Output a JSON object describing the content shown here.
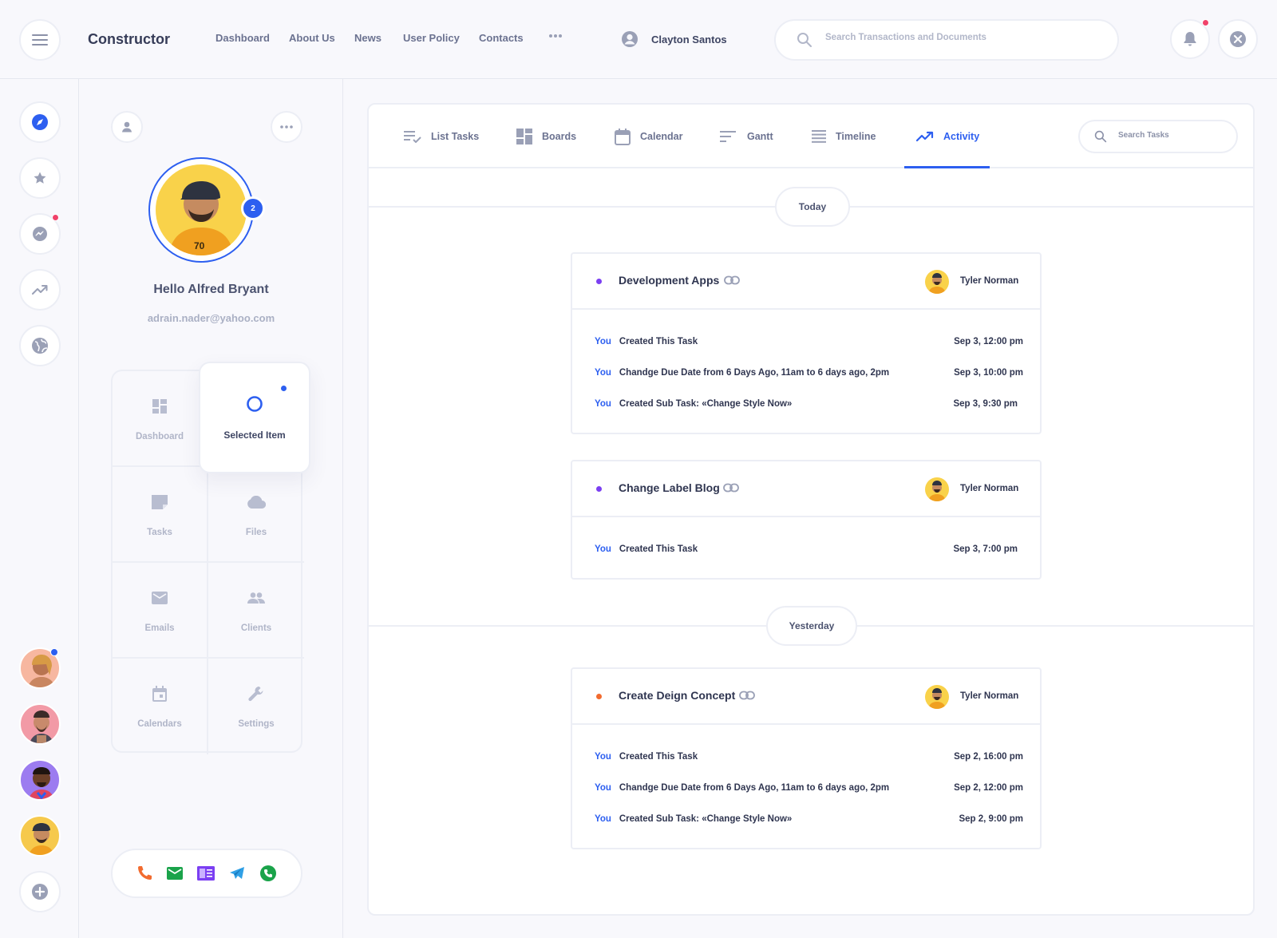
{
  "app": {
    "title": "Constructor"
  },
  "nav": [
    "Dashboard",
    "About Us",
    "News",
    "User Policy",
    "Contacts"
  ],
  "header": {
    "user_name": "Clayton Santos",
    "search_placeholder": "Search Transactions and Documents"
  },
  "profile": {
    "greeting": "Hello Alfred Bryant",
    "email": "adrain.nader@yahoo.com",
    "badge_count": "2"
  },
  "menu": {
    "dashboard": "Dashboard",
    "selected": "Selected Item",
    "tasks": "Tasks",
    "files": "Files",
    "emails": "Emails",
    "clients": "Clients",
    "calendars": "Calendars",
    "settings": "Settings"
  },
  "tabs": [
    "List Tasks",
    "Boards",
    "Calendar",
    "Gantt",
    "Timeline",
    "Activity"
  ],
  "active_tab": "Activity",
  "task_search_placeholder": "Search Tasks",
  "activity": {
    "today_label": "Today",
    "yesterday_label": "Yesterday",
    "cards": [
      {
        "title": "Development Apps",
        "user": "Tyler Norman",
        "dot_color": "#7b3ff2",
        "rows": [
          {
            "who": "You",
            "text": "Created This Task",
            "time": "Sep 3, 12:00 pm"
          },
          {
            "who": "You",
            "text": "Chandge Due Date from 6 Days Ago, 11am to 6 days ago, 2pm",
            "time": "Sep 3, 10:00 pm"
          },
          {
            "who": "You",
            "text": "Created Sub Task: «Change Style Now»",
            "time": "Sep 3, 9:30 pm"
          }
        ]
      },
      {
        "title": "Change Label Blog",
        "user": "Tyler Norman",
        "dot_color": "#7b3ff2",
        "rows": [
          {
            "who": "You",
            "text": "Created This Task",
            "time": "Sep 3, 7:00 pm"
          }
        ]
      },
      {
        "title": "Create Deign Concept",
        "user": "Tyler Norman",
        "dot_color": "#f26b2f",
        "rows": [
          {
            "who": "You",
            "text": "Created This Task",
            "time": "Sep 2, 16:00 pm"
          },
          {
            "who": "You",
            "text": "Chandge Due Date from 6 Days Ago, 11am to 6 days ago, 2pm",
            "time": "Sep 2, 12:00 pm"
          },
          {
            "who": "You",
            "text": "Created Sub Task: «Change Style Now»",
            "time": "Sep 2, 9:00 pm"
          }
        ]
      }
    ]
  },
  "colors": {
    "accent": "#2d5ff0",
    "notification": "#f0426a",
    "purple_dot": "#7b3ff2",
    "orange_dot": "#f26b2f"
  }
}
